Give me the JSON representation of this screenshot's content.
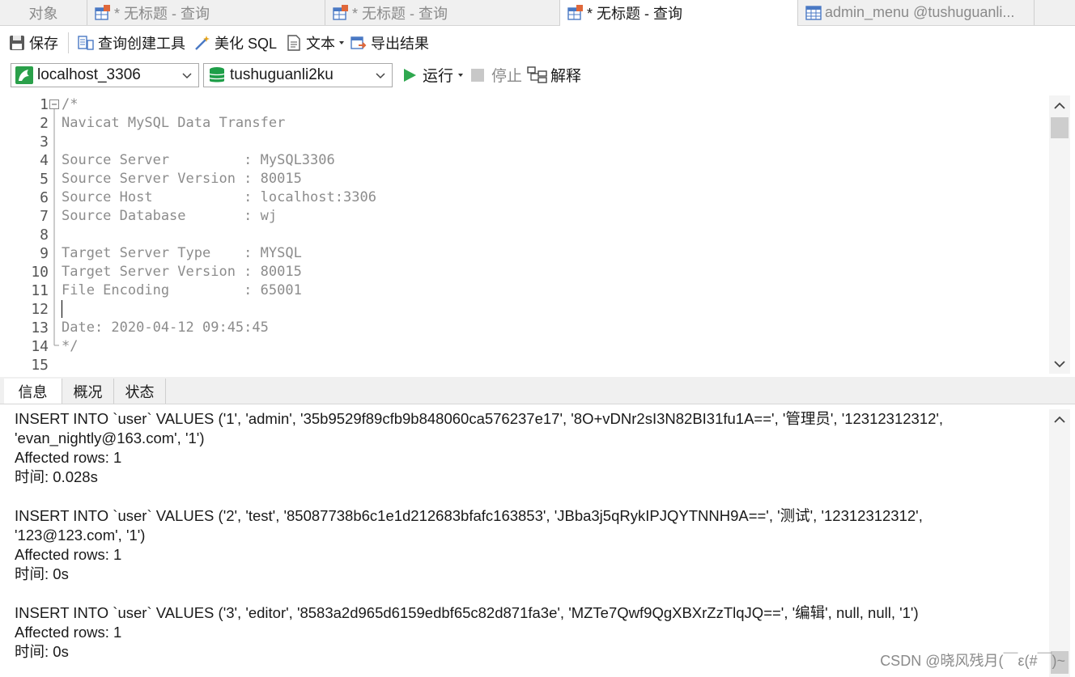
{
  "tabs": [
    {
      "label": "对象",
      "icon": "none",
      "active": false
    },
    {
      "label": "* 无标题 - 查询",
      "icon": "query-table-icon",
      "active": false
    },
    {
      "label": "* 无标题 - 查询",
      "icon": "query-table-icon",
      "active": false
    },
    {
      "label": "* 无标题 - 查询",
      "icon": "query-table-icon",
      "active": true
    },
    {
      "label": "admin_menu @tushuguanli...",
      "icon": "table-icon",
      "active": false
    }
  ],
  "toolbar": {
    "save": "保存",
    "query_builder": "查询创建工具",
    "beautify": "美化 SQL",
    "text": "文本",
    "export": "导出结果"
  },
  "connection": {
    "value": "localhost_3306"
  },
  "database": {
    "value": "tushuguanli2ku"
  },
  "run": {
    "run": "运行",
    "stop": "停止",
    "explain": "解释"
  },
  "editor": {
    "lines": [
      "/*",
      "Navicat MySQL Data Transfer",
      "",
      "Source Server         : MySQL3306",
      "Source Server Version : 80015",
      "Source Host           : localhost:3306",
      "Source Database       : wj",
      "",
      "Target Server Type    : MYSQL",
      "Target Server Version : 80015",
      "File Encoding         : 65001",
      "",
      "Date: 2020-04-12 09:45:45",
      "*/",
      ""
    ],
    "line_numbers": [
      "1",
      "2",
      "3",
      "4",
      "5",
      "6",
      "7",
      "8",
      "9",
      "10",
      "11",
      "12",
      "13",
      "14",
      "15"
    ]
  },
  "result_tabs": [
    {
      "label": "信息",
      "active": true
    },
    {
      "label": "概况",
      "active": false
    },
    {
      "label": "状态",
      "active": false
    }
  ],
  "results": {
    "lines": [
      "INSERT INTO `user` VALUES ('1', 'admin', '35b9529f89cfb9b848060ca576237e17', '8O+vDNr2sI3N82BI31fu1A==', '管理员', '12312312312',",
      "'evan_nightly@163.com', '1')",
      "Affected rows: 1",
      "时间: 0.028s",
      "",
      "INSERT INTO `user` VALUES ('2', 'test', '85087738b6c1e1d212683bfafc163853', 'JBba3j5qRykIPJQYTNNH9A==', '测试', '12312312312',",
      "'123@123.com', '1')",
      "Affected rows: 1",
      "时间: 0s",
      "",
      "INSERT INTO `user` VALUES ('3', 'editor', '8583a2d965d6159edbf65c82d871fa3e', 'MZTe7Qwf9QgXBXrZzTlqJQ==', '编辑', null, null, '1')",
      "Affected rows: 1",
      "时间: 0s"
    ]
  },
  "watermark": "CSDN @晓风残月(￣ε(#￣)~",
  "colors": {
    "run_green": "#2fa84f",
    "db_green": "#1e9e48",
    "tab_bg": "#f0f0f0"
  }
}
